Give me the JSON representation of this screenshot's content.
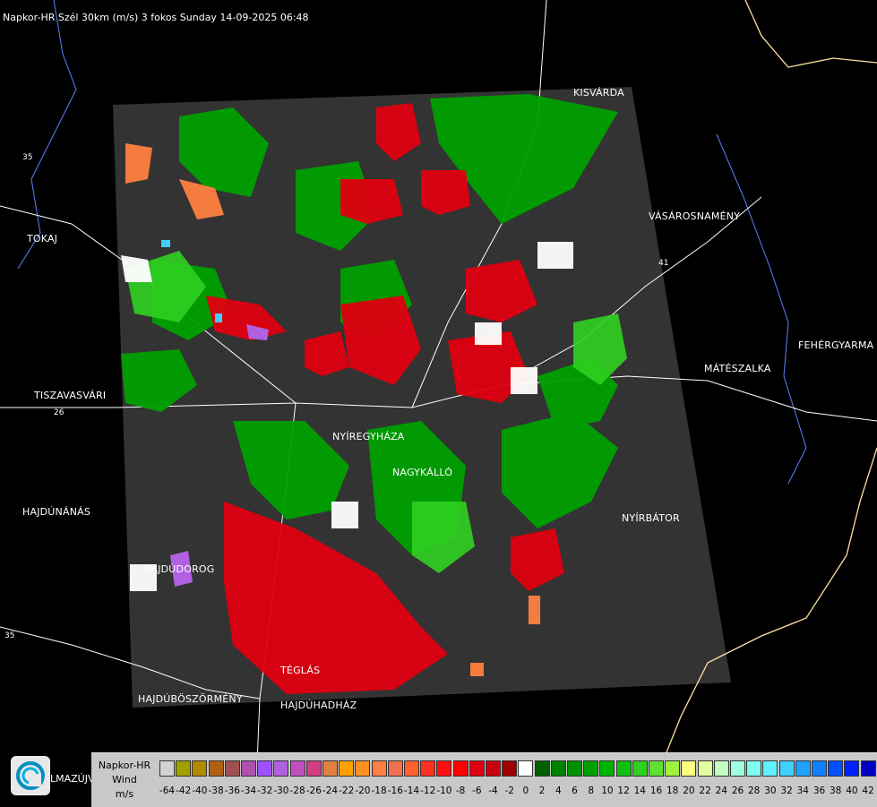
{
  "header": {
    "title": "Napkor-HR Szél 30km (m/s) 3 fokos Sunday 14-09-2025 06:48"
  },
  "cities": {
    "kisvarda": "KISVÁRDA",
    "tokaj": "TOKAJ",
    "vasarosnameny": "VÁSÁROSNAMÉNY",
    "fehergyarmat": "FEHÉRGYARMA",
    "mateszalka": "MÁTÉSZALKA",
    "tiszavasvari": "TISZAVASVÁRI",
    "nyiregyhaza": "NYÍREGYHÁZA",
    "nagykallo": "NAGYKÁLLÓ",
    "hajdunanas": "HAJDÚNÁNÁS",
    "nyirbator": "NYÍRBÁTOR",
    "hajdudorog": "HAJDÚDOROG",
    "teglas": "TÉGLÁS",
    "hajduboszormeny": "HAJDÚBÖSZÖRMÉNY",
    "hajduhadhaz": "HAJDÚHADHÁZ",
    "balmazujvaros_partial": "LMAZÚJVÁR"
  },
  "roads": {
    "r26": "26",
    "r35": "35",
    "r41": "41",
    "r35b": "35"
  },
  "legend": {
    "line1": "Napkor-HR",
    "line2": "Wind",
    "line3": "m/s",
    "scale": [
      {
        "v": "-64",
        "c": "#d2d2d2"
      },
      {
        "v": "-42",
        "c": "#a0a000"
      },
      {
        "v": "-40",
        "c": "#b08a00"
      },
      {
        "v": "-38",
        "c": "#b06010"
      },
      {
        "v": "-36",
        "c": "#a05050"
      },
      {
        "v": "-34",
        "c": "#b050b0"
      },
      {
        "v": "-32",
        "c": "#a050ff"
      },
      {
        "v": "-30",
        "c": "#b060e0"
      },
      {
        "v": "-28",
        "c": "#c050c0"
      },
      {
        "v": "-26",
        "c": "#d04080"
      },
      {
        "v": "-24",
        "c": "#e08040"
      },
      {
        "v": "-22",
        "c": "#ffa000"
      },
      {
        "v": "-20",
        "c": "#ff9020"
      },
      {
        "v": "-18",
        "c": "#ff8040"
      },
      {
        "v": "-16",
        "c": "#f07050"
      },
      {
        "v": "-14",
        "c": "#ff6030"
      },
      {
        "v": "-12",
        "c": "#ff3020"
      },
      {
        "v": "-10",
        "c": "#ff1010"
      },
      {
        "v": "-8",
        "c": "#ff0000"
      },
      {
        "v": "-6",
        "c": "#e00010"
      },
      {
        "v": "-4",
        "c": "#c80010"
      },
      {
        "v": "-2",
        "c": "#a00000"
      },
      {
        "v": "0",
        "c": "#ffffff"
      },
      {
        "v": "2",
        "c": "#006000"
      },
      {
        "v": "4",
        "c": "#008000"
      },
      {
        "v": "6",
        "c": "#009000"
      },
      {
        "v": "8",
        "c": "#00a000"
      },
      {
        "v": "10",
        "c": "#00b400"
      },
      {
        "v": "12",
        "c": "#10c010"
      },
      {
        "v": "14",
        "c": "#30d020"
      },
      {
        "v": "16",
        "c": "#60e030"
      },
      {
        "v": "18",
        "c": "#a0f040"
      },
      {
        "v": "20",
        "c": "#ffff80"
      },
      {
        "v": "22",
        "c": "#e0ffa0"
      },
      {
        "v": "24",
        "c": "#c0ffc0"
      },
      {
        "v": "26",
        "c": "#a0ffe0"
      },
      {
        "v": "28",
        "c": "#80fff0"
      },
      {
        "v": "30",
        "c": "#60f0ff"
      },
      {
        "v": "32",
        "c": "#40d0ff"
      },
      {
        "v": "34",
        "c": "#20a0ff"
      },
      {
        "v": "36",
        "c": "#1080ff"
      },
      {
        "v": "38",
        "c": "#0050ff"
      },
      {
        "v": "40",
        "c": "#0020ff"
      },
      {
        "v": "42",
        "c": "#0000c0"
      }
    ]
  },
  "colors": {
    "radar_area": "#333333",
    "road": "#ffffff",
    "border": "#ffe0a0",
    "river": "#6080ff"
  }
}
